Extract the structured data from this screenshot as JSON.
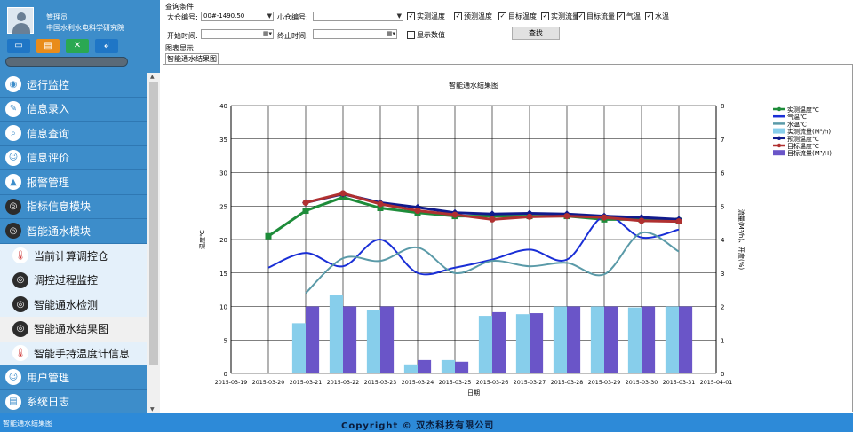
{
  "user": {
    "name": "管理员",
    "org": "中国水利水电科学研究院"
  },
  "quick_buttons": [
    {
      "icon": "monitor-icon",
      "glyph": "▭",
      "color": "#1f76c6"
    },
    {
      "icon": "document-icon",
      "glyph": "▤",
      "color": "#e98c1a"
    },
    {
      "icon": "tools-icon",
      "glyph": "✕",
      "color": "#2aa852"
    },
    {
      "icon": "exit-icon",
      "glyph": "↲",
      "color": "#1f76c6"
    }
  ],
  "menu": [
    {
      "label": "运行监控",
      "icon": "monitor-icon",
      "glyph": "◉",
      "style": "w"
    },
    {
      "label": "信息录入",
      "icon": "edit-icon",
      "glyph": "✎",
      "style": "w"
    },
    {
      "label": "信息查询",
      "icon": "search-icon",
      "glyph": "⌕",
      "style": "w"
    },
    {
      "label": "信息评价",
      "icon": "people-icon",
      "glyph": "☺",
      "style": "w"
    },
    {
      "label": "报警管理",
      "icon": "alarm-icon",
      "glyph": "▲",
      "style": "w"
    },
    {
      "label": "指标信息模块",
      "icon": "eye-icon",
      "glyph": "◎",
      "style": "d"
    },
    {
      "label": "智能通水模块",
      "icon": "eye-icon",
      "glyph": "◎",
      "style": "d"
    }
  ],
  "submenu": [
    {
      "label": "当前计算调控仓",
      "icon": "thermometer-icon",
      "glyph": "🌡",
      "active": false
    },
    {
      "label": "调控过程监控",
      "icon": "eye-icon",
      "glyph": "◎",
      "active": false
    },
    {
      "label": "智能通水检测",
      "icon": "eye-icon",
      "glyph": "◎",
      "active": false
    },
    {
      "label": "智能通水结果图",
      "icon": "eye-icon",
      "glyph": "◎",
      "active": true
    },
    {
      "label": "智能手持温度计信息",
      "icon": "thermometer-icon",
      "glyph": "🌡",
      "active": false
    }
  ],
  "menu_bottom": [
    {
      "label": "用户管理",
      "icon": "user-icon",
      "glyph": "☺",
      "style": "w"
    },
    {
      "label": "系统日志",
      "icon": "log-icon",
      "glyph": "▤",
      "style": "w"
    }
  ],
  "query": {
    "title": "查询条件",
    "big_label": "大仓编号:",
    "big_value": "00#-1490.50",
    "small_label": "小仓编号:",
    "small_value": "",
    "start_label": "开始时间:",
    "start_value": "",
    "end_label": "终止时间:",
    "end_value": "",
    "checkboxes": [
      {
        "label": "实测温度",
        "checked": true
      },
      {
        "label": "预测温度",
        "checked": true
      },
      {
        "label": "目标温度",
        "checked": true
      },
      {
        "label": "实测流量",
        "checked": true
      },
      {
        "label": "目标流量",
        "checked": true
      },
      {
        "label": "气温",
        "checked": true
      },
      {
        "label": "水温",
        "checked": true
      }
    ],
    "show_values_label": "显示数值",
    "show_values_checked": false,
    "search_label": "查找"
  },
  "chart_section_label": "图表显示",
  "tab_label": "智能通水结果图",
  "status": {
    "left": "智能通水结果图",
    "copyright": "Copyright © 双杰科技有限公司"
  },
  "chart_data": {
    "type": "bar+line",
    "title": "智能通水结果图",
    "xlabel": "日期",
    "ylabel": "温度℃",
    "y2label": "流量(M³/h)、开度(%)",
    "x": [
      "2015-03-19",
      "2015-03-20",
      "2015-03-21",
      "2015-03-22",
      "2015-03-23",
      "2015-03-24",
      "2015-03-25",
      "2015-03-26",
      "2015-03-27",
      "2015-03-28",
      "2015-03-29",
      "2015-03-30",
      "2015-03-31",
      "2015-04-01"
    ],
    "ylim": [
      0,
      40
    ],
    "y2lim": [
      0,
      8
    ],
    "yticks": [
      0,
      5,
      10,
      15,
      20,
      25,
      30,
      35,
      40
    ],
    "y2ticks": [
      0,
      1,
      2,
      3,
      4,
      5,
      6,
      7,
      8
    ],
    "series": [
      {
        "name": "实测温度℃",
        "kind": "line",
        "color": "#1e8c3a",
        "marker": "square",
        "axis": "left",
        "points": [
          [
            "2015-03-20",
            20.5
          ],
          [
            "2015-03-21",
            24.3
          ],
          [
            "2015-03-22",
            26.3
          ],
          [
            "2015-03-23",
            24.7
          ],
          [
            "2015-03-24",
            24.0
          ],
          [
            "2015-03-25",
            23.5
          ],
          [
            "2015-03-26",
            23.5
          ],
          [
            "2015-03-27",
            23.5
          ],
          [
            "2015-03-28",
            23.5
          ],
          [
            "2015-03-29",
            23.0
          ],
          [
            "2015-03-30",
            23.0
          ],
          [
            "2015-03-31",
            22.8
          ]
        ]
      },
      {
        "name": "气温℃",
        "kind": "curve",
        "color": "#1a2fd6",
        "axis": "left",
        "points": [
          [
            "2015-03-20",
            15.8
          ],
          [
            "2015-03-21",
            18.0
          ],
          [
            "2015-03-22",
            16.0
          ],
          [
            "2015-03-23",
            20.0
          ],
          [
            "2015-03-24",
            15.0
          ],
          [
            "2015-03-25",
            15.8
          ],
          [
            "2015-03-26",
            17.0
          ],
          [
            "2015-03-27",
            18.5
          ],
          [
            "2015-03-28",
            17.0
          ],
          [
            "2015-03-29",
            23.5
          ],
          [
            "2015-03-30",
            20.3
          ],
          [
            "2015-03-31",
            21.5
          ]
        ]
      },
      {
        "name": "水温℃",
        "kind": "curve",
        "color": "#5a9aa8",
        "axis": "left",
        "points": [
          [
            "2015-03-21",
            12.0
          ],
          [
            "2015-03-22",
            17.2
          ],
          [
            "2015-03-23",
            16.8
          ],
          [
            "2015-03-24",
            18.8
          ],
          [
            "2015-03-25",
            15.0
          ],
          [
            "2015-03-26",
            16.8
          ],
          [
            "2015-03-27",
            16.0
          ],
          [
            "2015-03-28",
            16.5
          ],
          [
            "2015-03-29",
            14.8
          ],
          [
            "2015-03-30",
            21.0
          ],
          [
            "2015-03-31",
            18.2
          ]
        ]
      },
      {
        "name": "实测流量(M³/h)",
        "kind": "bar",
        "color": "#87ceeb",
        "axis": "right",
        "points": [
          [
            "2015-03-21",
            1.5
          ],
          [
            "2015-03-22",
            2.35
          ],
          [
            "2015-03-23",
            1.9
          ],
          [
            "2015-03-24",
            0.27
          ],
          [
            "2015-03-25",
            0.4
          ],
          [
            "2015-03-26",
            1.72
          ],
          [
            "2015-03-27",
            1.77
          ],
          [
            "2015-03-28",
            2.0
          ],
          [
            "2015-03-29",
            2.0
          ],
          [
            "2015-03-30",
            1.97
          ],
          [
            "2015-03-31",
            2.0
          ]
        ]
      },
      {
        "name": "预测温度℃",
        "kind": "line",
        "color": "#101a8c",
        "marker": "diamond",
        "axis": "left",
        "points": [
          [
            "2015-03-21",
            25.5
          ],
          [
            "2015-03-22",
            26.8
          ],
          [
            "2015-03-23",
            25.5
          ],
          [
            "2015-03-24",
            24.8
          ],
          [
            "2015-03-25",
            24.0
          ],
          [
            "2015-03-26",
            23.8
          ],
          [
            "2015-03-27",
            23.9
          ],
          [
            "2015-03-28",
            23.8
          ],
          [
            "2015-03-29",
            23.5
          ],
          [
            "2015-03-30",
            23.3
          ],
          [
            "2015-03-31",
            23.0
          ]
        ]
      },
      {
        "name": "目标温度℃",
        "kind": "line",
        "color": "#b03030",
        "marker": "triangle",
        "axis": "left",
        "points": [
          [
            "2015-03-21",
            25.5
          ],
          [
            "2015-03-22",
            26.9
          ],
          [
            "2015-03-23",
            25.3
          ],
          [
            "2015-03-24",
            24.3
          ],
          [
            "2015-03-25",
            23.7
          ],
          [
            "2015-03-26",
            23.0
          ],
          [
            "2015-03-27",
            23.4
          ],
          [
            "2015-03-28",
            23.5
          ],
          [
            "2015-03-29",
            23.3
          ],
          [
            "2015-03-30",
            22.8
          ],
          [
            "2015-03-31",
            22.7
          ]
        ]
      },
      {
        "name": "目标流量(M³/H)",
        "kind": "bar",
        "color": "#6a55c8",
        "axis": "right",
        "points": [
          [
            "2015-03-21",
            2.0
          ],
          [
            "2015-03-22",
            2.0
          ],
          [
            "2015-03-23",
            2.0
          ],
          [
            "2015-03-24",
            0.4
          ],
          [
            "2015-03-25",
            0.35
          ],
          [
            "2015-03-26",
            1.83
          ],
          [
            "2015-03-27",
            1.8
          ],
          [
            "2015-03-28",
            2.0
          ],
          [
            "2015-03-29",
            2.0
          ],
          [
            "2015-03-30",
            2.0
          ],
          [
            "2015-03-31",
            2.0
          ]
        ]
      }
    ],
    "legend_position": "right-top",
    "grid": true
  }
}
